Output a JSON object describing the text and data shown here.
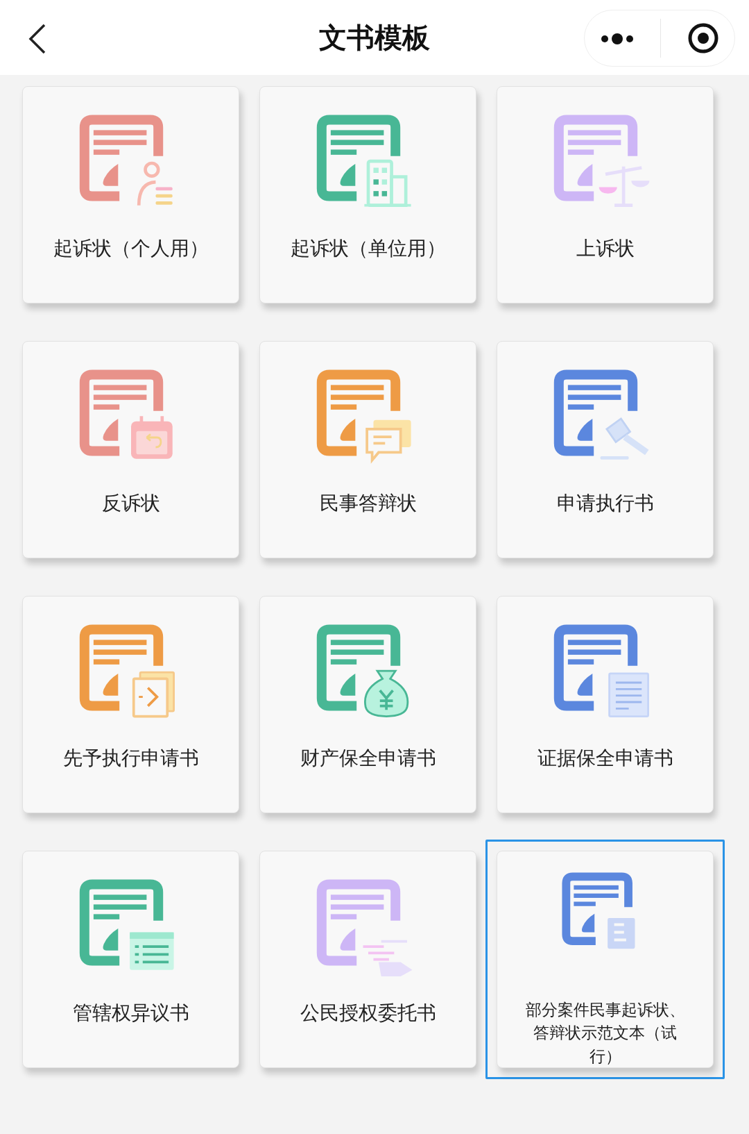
{
  "header": {
    "title": "文书模板"
  },
  "templates": [
    {
      "label": "起诉状（个人用）",
      "color": "#e8928a",
      "selected": false
    },
    {
      "label": "起诉状（单位用）",
      "color": "#48b795",
      "selected": false
    },
    {
      "label": "上诉状",
      "color": "#cdb6f6",
      "selected": false
    },
    {
      "label": "反诉状",
      "color": "#e8928a",
      "selected": false
    },
    {
      "label": "民事答辩状",
      "color": "#ee9b45",
      "selected": false
    },
    {
      "label": "申请执行书",
      "color": "#5b87de",
      "selected": false
    },
    {
      "label": "先予执行申请书",
      "color": "#ee9b45",
      "selected": false
    },
    {
      "label": "财产保全申请书",
      "color": "#48b795",
      "selected": false
    },
    {
      "label": "证据保全申请书",
      "color": "#5b87de",
      "selected": false
    },
    {
      "label": "管辖权异议书",
      "color": "#48b795",
      "selected": false
    },
    {
      "label": "公民授权委托书",
      "color": "#cdb6f6",
      "selected": false
    },
    {
      "label": "部分案件民事起诉状、答辩状示范文本（试行）",
      "color": "#5b87de",
      "selected": true
    }
  ]
}
